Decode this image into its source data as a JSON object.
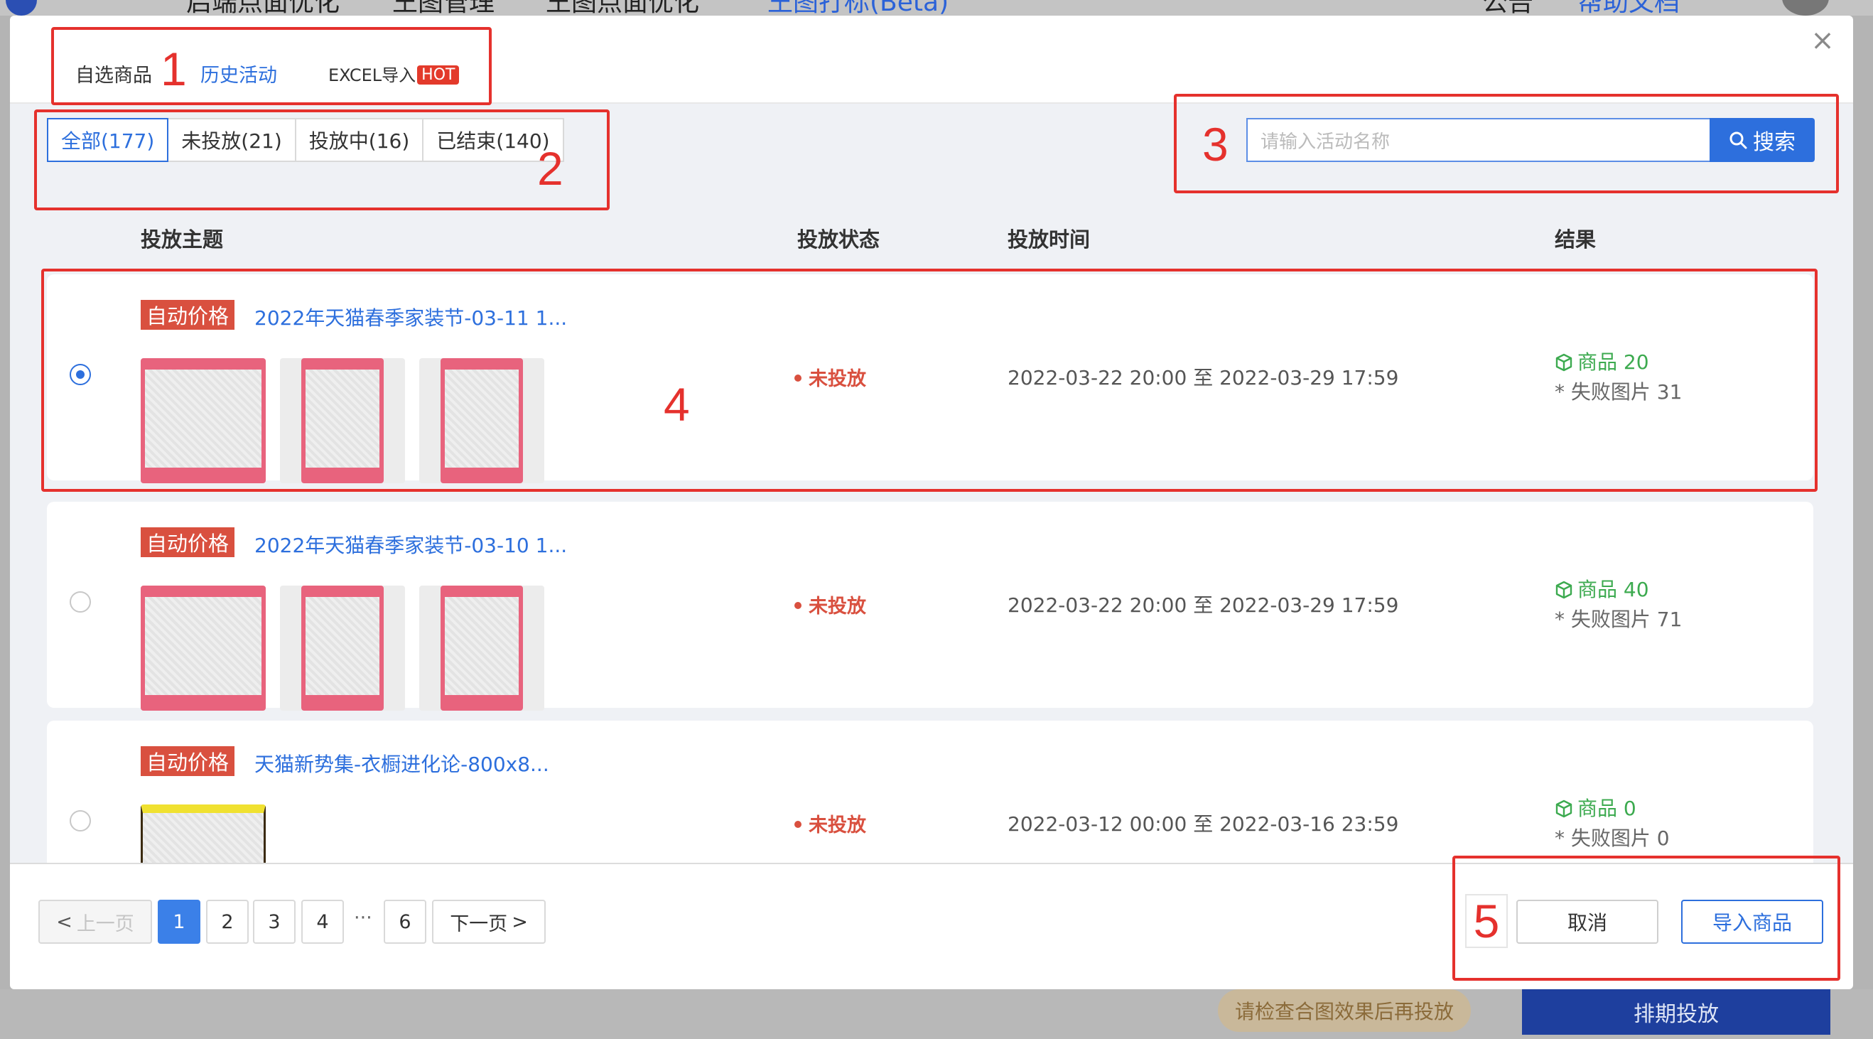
{
  "background": {
    "nav_items": [
      "启端点面优化",
      "王图管理",
      "王图点面优化",
      "王图打标(Beta)"
    ],
    "right_items": [
      "公告",
      "帮助文档"
    ],
    "check_button": "请检查合图效果后再投放",
    "schedule_button": "排期投放"
  },
  "modal": {
    "close_icon": "close-icon",
    "tabs": [
      {
        "label": "自选商品",
        "active": false
      },
      {
        "label": "历史活动",
        "active": true
      },
      {
        "label": "EXCEL导入",
        "badge": "HOT",
        "active": false
      }
    ],
    "filters": [
      {
        "label": "全部(177)",
        "active": true
      },
      {
        "label": "未投放(21)",
        "active": false
      },
      {
        "label": "投放中(16)",
        "active": false
      },
      {
        "label": "已结束(140)",
        "active": false
      }
    ],
    "search": {
      "placeholder": "请输入活动名称",
      "button": "搜索"
    },
    "columns": [
      "投放主题",
      "投放状态",
      "投放时间",
      "结果"
    ],
    "rows": [
      {
        "selected": true,
        "tag": "自动价格",
        "title": "2022年天猫春季家装节-03-11 1...",
        "status": "未投放",
        "time": "2022-03-22 20:00 至 2022-03-29 17:59",
        "goods": "商品 20",
        "fail": "* 失败图片 31"
      },
      {
        "selected": false,
        "tag": "自动价格",
        "title": "2022年天猫春季家装节-03-10 1...",
        "status": "未投放",
        "time": "2022-03-22 20:00 至 2022-03-29 17:59",
        "goods": "商品 40",
        "fail": "* 失败图片 71"
      },
      {
        "selected": false,
        "tag": "自动价格",
        "title": "天猫新势集-衣橱进化论-800x8...",
        "status": "未投放",
        "time": "2022-03-12 00:00 至 2022-03-16 23:59",
        "goods": "商品 0",
        "fail": "* 失败图片 0"
      }
    ],
    "pagination": {
      "prev": "上一页",
      "pages": [
        "1",
        "2",
        "3",
        "4",
        "6"
      ],
      "ellipsis": "···",
      "current": "1",
      "next": "下一页"
    },
    "footer": {
      "cancel": "取消",
      "import": "导入商品"
    }
  },
  "annotations": [
    "1",
    "2",
    "3",
    "4",
    "5"
  ],
  "colors": {
    "accent": "#2d6fdd",
    "tag_red": "#d9503f",
    "annotation_red": "#e5312d",
    "success_green": "#3caa4f"
  }
}
